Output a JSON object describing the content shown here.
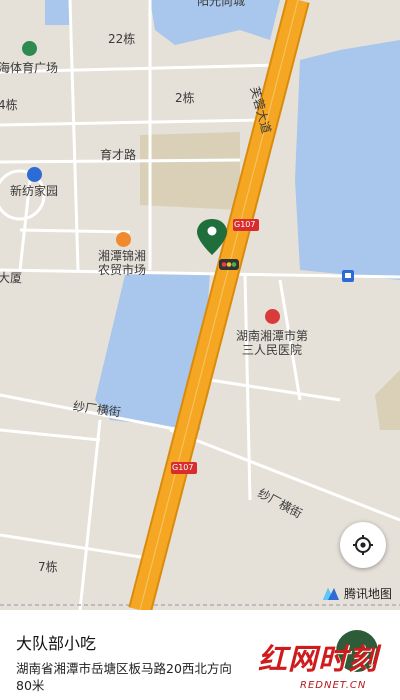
{
  "map": {
    "labels": {
      "yangguang": "阳光尚城",
      "b22": "22栋",
      "haiti": "海体育广场",
      "b4": "4栋",
      "b2": "2栋",
      "yucai": "育才路",
      "furong": "芙蓉大道",
      "xinfang": "新纺家园",
      "g107_top": "G107",
      "xiangtan_market": "湘潭锦湘\n农贸市场",
      "dasha": "大厦",
      "hospital": "湖南湘潭市第\n三人民医院",
      "shachang1": "纱厂横街",
      "g107_bottom": "G107",
      "shachang2": "纱厂横街",
      "b7": "7栋"
    },
    "colors": {
      "land": "#e5e0d8",
      "water": "#a9c6ec",
      "green": "#d9d0b7",
      "road": "#ffffff",
      "highway": "#f5a623",
      "pin": "#1f6e3b"
    }
  },
  "controls": {
    "locate_icon": "crosshair-icon",
    "attribution_text": "腾讯地图"
  },
  "place": {
    "name": "大队部小吃",
    "address": "湖南省湘潭市岳塘区板马路20西北方向",
    "distance": "80米"
  },
  "watermark": {
    "title": "红网时刻",
    "subtitle": "REDNET.CN"
  }
}
